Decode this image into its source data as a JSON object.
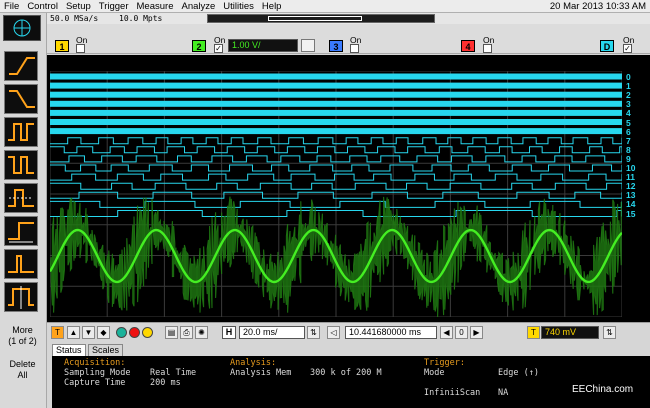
{
  "menu": {
    "items": [
      "File",
      "Control",
      "Setup",
      "Trigger",
      "Measure",
      "Analyze",
      "Utilities",
      "Help"
    ],
    "datetime": "20 Mar 2013 10:33 AM"
  },
  "acquisition_header": {
    "sample_rate": "50.0 MSa/s",
    "memory_depth": "10.0 Mpts"
  },
  "channels": [
    {
      "number": "1",
      "on_label": "On",
      "checked": false,
      "color": "#ffd800"
    },
    {
      "number": "2",
      "on_label": "On",
      "checked": true,
      "color": "#44ee22",
      "scale": "1.00 V/"
    },
    {
      "number": "3",
      "on_label": "On",
      "checked": false,
      "color": "#3a7bff"
    },
    {
      "number": "4",
      "on_label": "On",
      "checked": false,
      "color": "#ff3030"
    },
    {
      "number": "D",
      "on_label": "On",
      "checked": true,
      "color": "#27d7ee"
    }
  ],
  "left_toolbar": {
    "more_label": "More",
    "more_page": "(1 of 2)",
    "delete_label": "Delete",
    "delete_all_label": "All"
  },
  "digital_labels": [
    "0",
    "1",
    "2",
    "3",
    "4",
    "5",
    "6",
    "7",
    "8",
    "9",
    "10",
    "11",
    "12",
    "13",
    "14",
    "15"
  ],
  "bottom_bar": {
    "horizontal_label": "H",
    "timebase": "20.0 ms/",
    "delay": "10.441680000 ms",
    "trigger_level": "740 mV"
  },
  "status": {
    "tabs": [
      "Status",
      "Scales"
    ],
    "acquisition": {
      "title": "Acquisition:",
      "mode_label": "Sampling Mode",
      "mode_value": "Real Time",
      "capture_label": "Capture Time",
      "capture_value": "200 ms"
    },
    "analysis": {
      "title": "Analysis:",
      "mem_label": "Analysis Mem",
      "mem_value": "300 k of 200 M"
    },
    "trigger": {
      "title": "Trigger:",
      "mode_label": "Mode",
      "mode_value": "Edge (↑)",
      "infiniiscan_label": "InfiniiScan",
      "infiniiscan_value": "NA"
    }
  },
  "watermark": "EEChina.com",
  "colors": {
    "digital": "#27d7ee",
    "analog_ch2": "#44ee22",
    "grid": "#3a3a3a",
    "status_heading": "#e69b1e"
  },
  "icons": [
    "edge-rising-icon",
    "edge-falling-icon",
    "pulse-positive-icon",
    "pulse-negative-icon",
    "runt-icon",
    "timeout-icon",
    "glitch-icon",
    "setup-hold-icon",
    "window-icon",
    "search-icon"
  ]
}
